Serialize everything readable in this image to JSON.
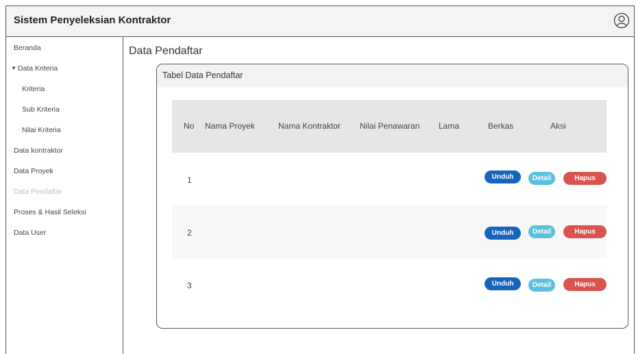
{
  "app": {
    "title": "Sistem Penyeleksian Kontraktor"
  },
  "icons": {
    "user": "user-circle-icon",
    "caret": "caret-down-icon"
  },
  "colors": {
    "unduh": "#1565c0",
    "detail": "#5bc0de",
    "hapus": "#d9534f"
  },
  "sidebar": {
    "items": [
      {
        "label": "Beranda"
      },
      {
        "label": "Data Kriteria"
      },
      {
        "label": "Kriteria"
      },
      {
        "label": "Sub Kriteria"
      },
      {
        "label": "Nilai Kriteria"
      },
      {
        "label": "Data kontraktor"
      },
      {
        "label": "Data Proyek"
      },
      {
        "label": "Data Pendaftar"
      },
      {
        "label": "Proses & Hasil Seleksi"
      },
      {
        "label": "Data User"
      }
    ]
  },
  "main": {
    "page_title": "Data Pendaftar",
    "card_title": "Tabel Data Pendaftar",
    "columns": [
      "No",
      "Nama Proyek",
      "Nama Kontraktor",
      "Nilai Penawaran",
      "Lama",
      "Berkas",
      "Aksi"
    ],
    "rows": [
      {
        "no": "1",
        "unduh": "Unduh",
        "detail": "Detail",
        "hapus": "Hapus"
      },
      {
        "no": "2",
        "unduh": "Unduh",
        "detail": "Detail",
        "hapus": "Hapus"
      },
      {
        "no": "3",
        "unduh": "Unduh",
        "detail": "Detail",
        "hapus": "Hapus"
      }
    ]
  }
}
